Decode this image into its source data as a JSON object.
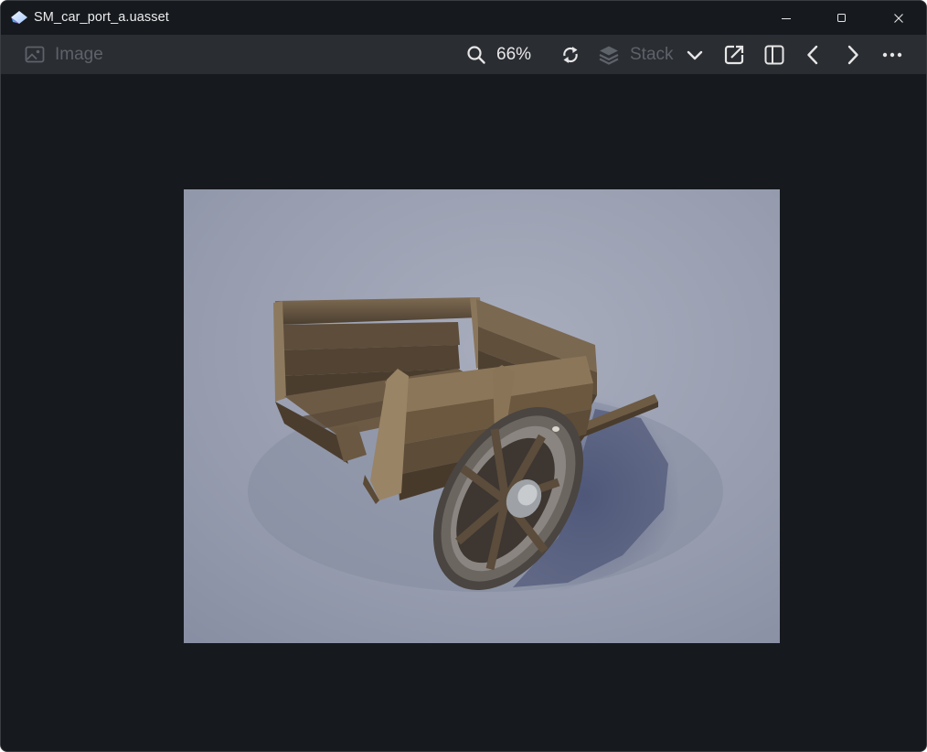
{
  "window": {
    "title": "SM_car_port_a.uasset"
  },
  "window_controls": {
    "minimize_icon": "minimize-icon",
    "maximize_icon": "maximize-icon",
    "close_icon": "close-icon"
  },
  "toolbar": {
    "image_label": "Image",
    "zoom_level": "66%",
    "stack_label": "Stack",
    "more_icon": "more-icon"
  },
  "colors": {
    "background": "#16191e",
    "toolbar": "#2a2d32",
    "disabled": "#5e6269",
    "text": "#e8e8e8"
  }
}
